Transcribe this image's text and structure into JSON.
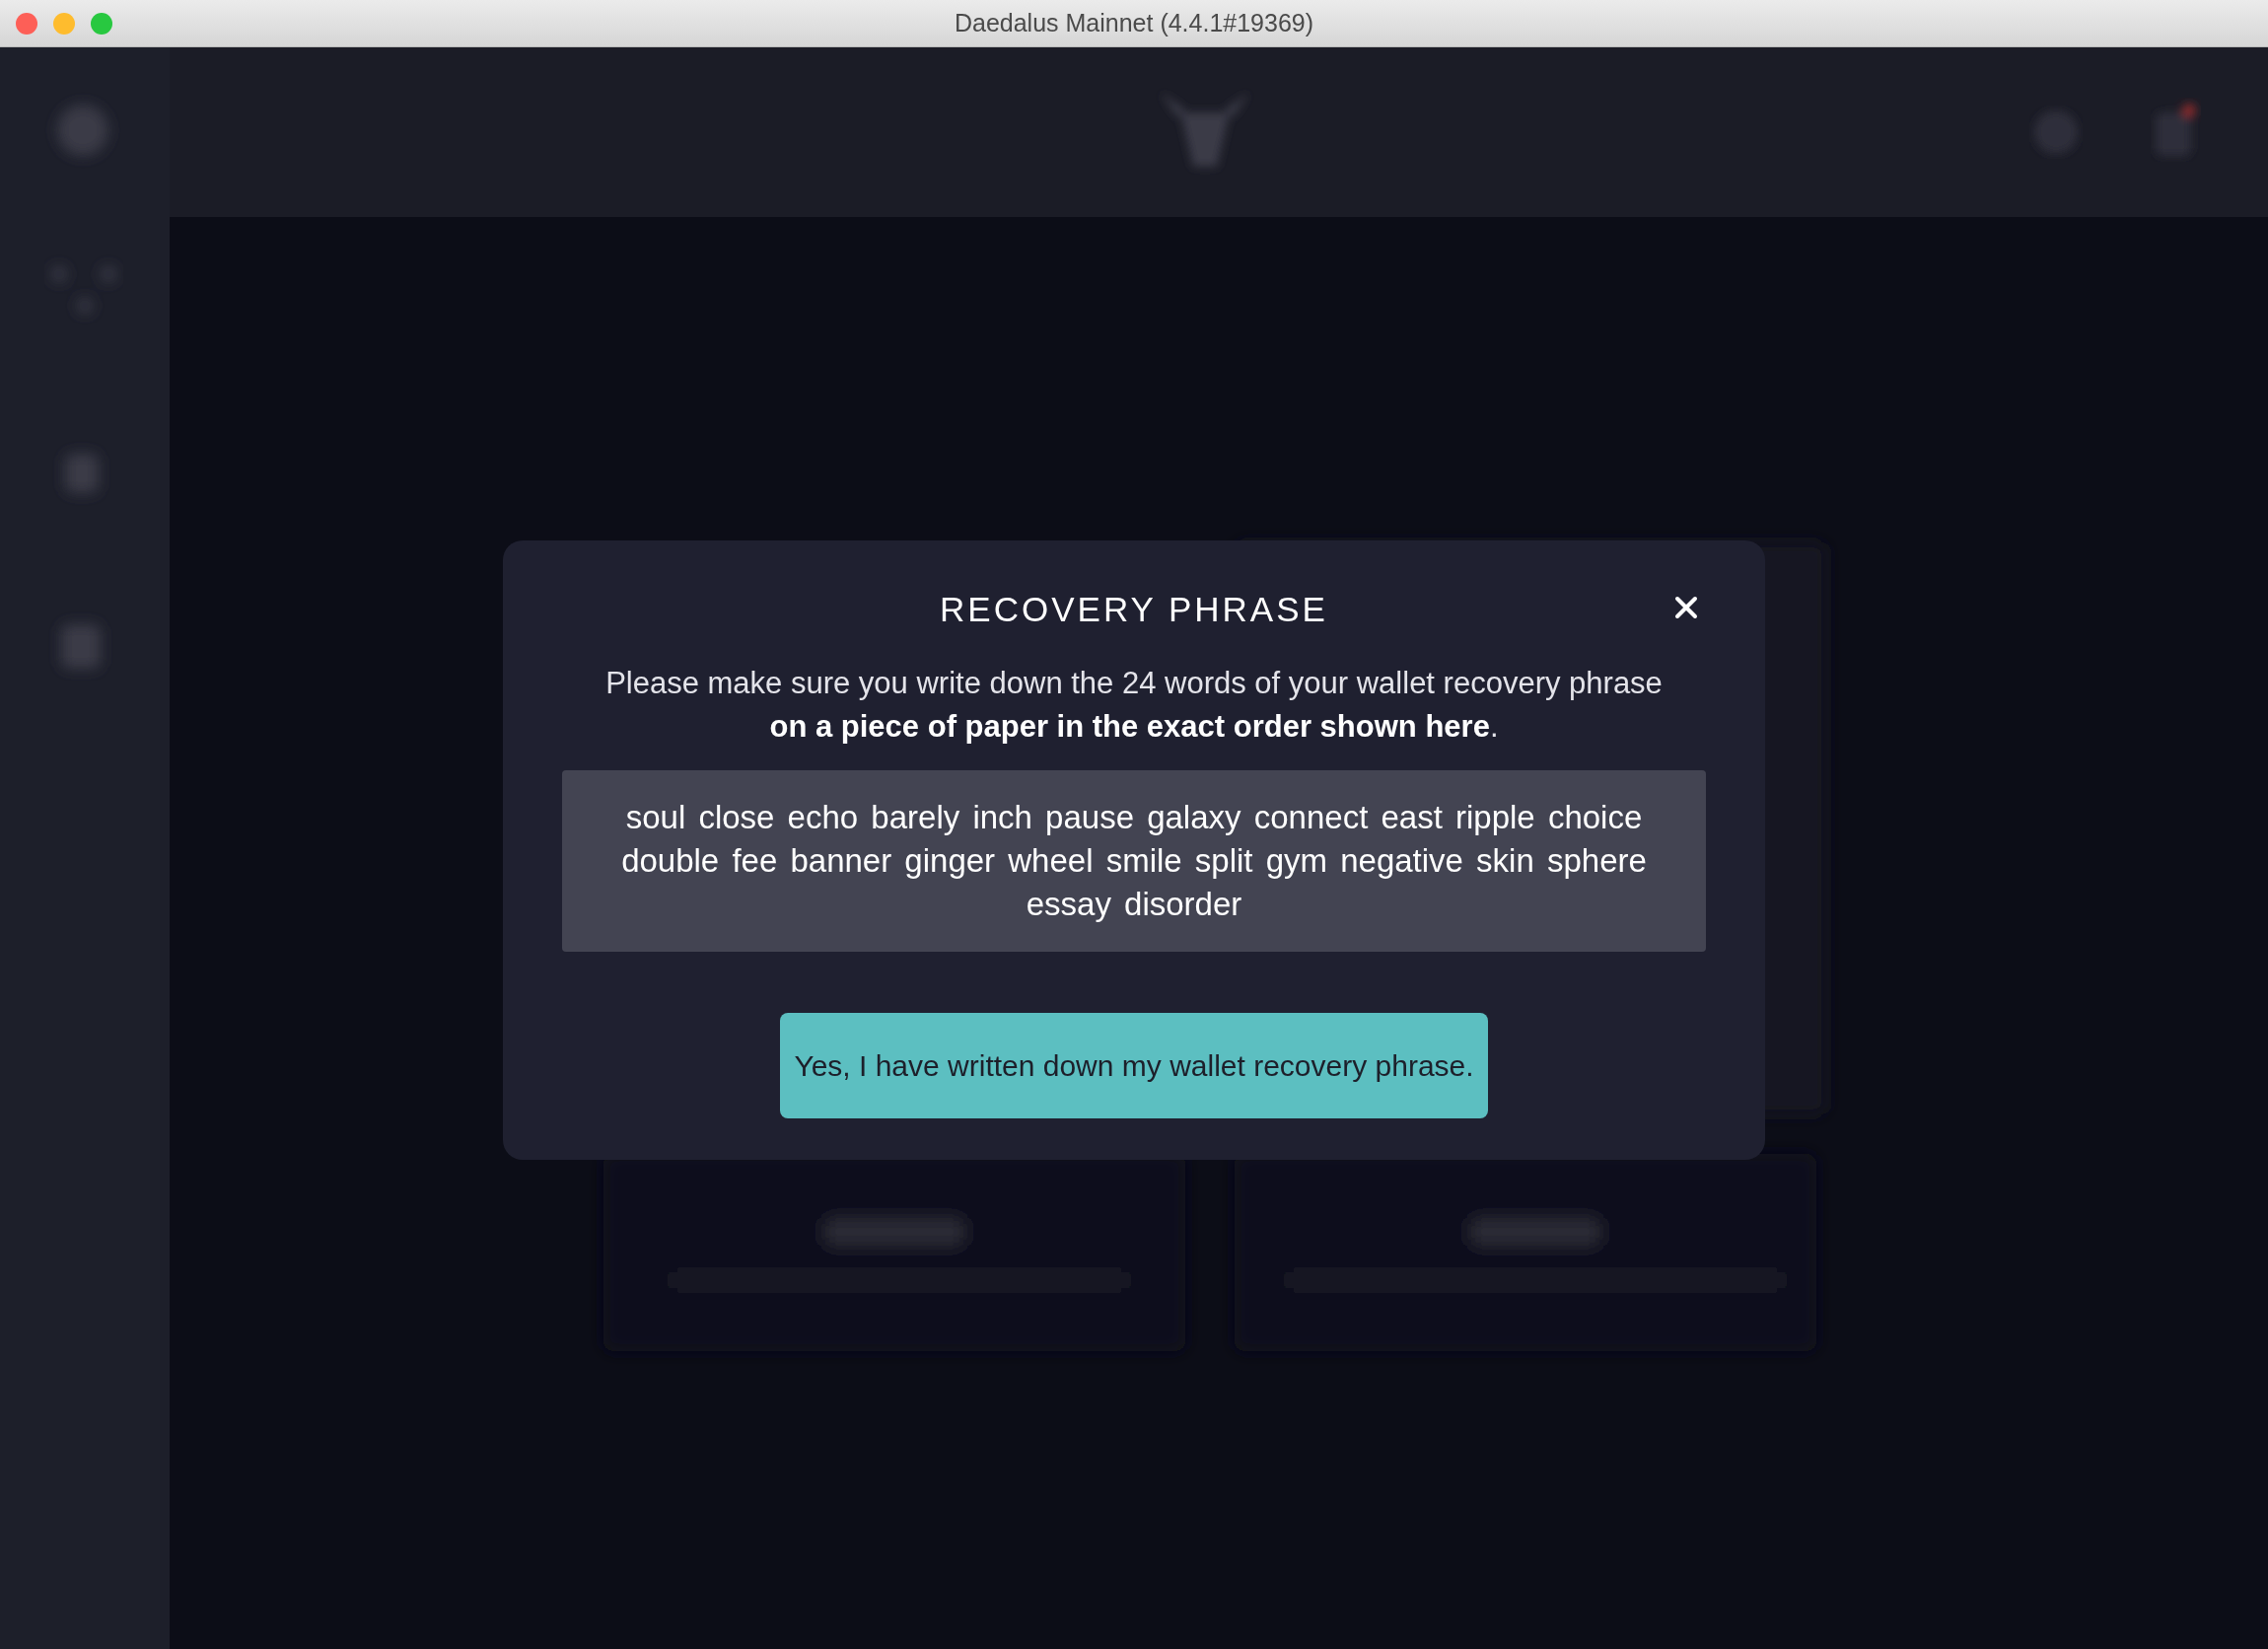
{
  "window": {
    "title": "Daedalus Mainnet (4.4.1#19369)"
  },
  "dialog": {
    "title": "RECOVERY PHRASE",
    "description": "Please make sure you write down the 24 words of your wallet recovery phrase **on a piece of paper in the exact order shown here**.",
    "phrase": "soul close echo barely inch pause galaxy connect east ripple choice double fee banner ginger wheel smile split gym negative skin sphere essay disorder",
    "confirm_button": "Yes, I have written down my wallet recovery phrase."
  }
}
